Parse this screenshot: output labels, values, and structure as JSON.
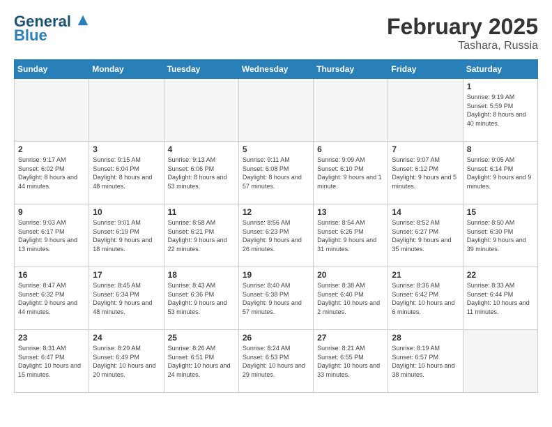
{
  "header": {
    "logo_line1": "General",
    "logo_line2": "Blue",
    "month_title": "February 2025",
    "location": "Tashara, Russia"
  },
  "days_of_week": [
    "Sunday",
    "Monday",
    "Tuesday",
    "Wednesday",
    "Thursday",
    "Friday",
    "Saturday"
  ],
  "weeks": [
    [
      {
        "day": "",
        "empty": true
      },
      {
        "day": "",
        "empty": true
      },
      {
        "day": "",
        "empty": true
      },
      {
        "day": "",
        "empty": true
      },
      {
        "day": "",
        "empty": true
      },
      {
        "day": "",
        "empty": true
      },
      {
        "day": "1",
        "sunrise": "9:19 AM",
        "sunset": "5:59 PM",
        "daylight": "8 hours and 40 minutes."
      }
    ],
    [
      {
        "day": "2",
        "sunrise": "9:17 AM",
        "sunset": "6:02 PM",
        "daylight": "8 hours and 44 minutes."
      },
      {
        "day": "3",
        "sunrise": "9:15 AM",
        "sunset": "6:04 PM",
        "daylight": "8 hours and 48 minutes."
      },
      {
        "day": "4",
        "sunrise": "9:13 AM",
        "sunset": "6:06 PM",
        "daylight": "8 hours and 53 minutes."
      },
      {
        "day": "5",
        "sunrise": "9:11 AM",
        "sunset": "6:08 PM",
        "daylight": "8 hours and 57 minutes."
      },
      {
        "day": "6",
        "sunrise": "9:09 AM",
        "sunset": "6:10 PM",
        "daylight": "9 hours and 1 minute."
      },
      {
        "day": "7",
        "sunrise": "9:07 AM",
        "sunset": "6:12 PM",
        "daylight": "9 hours and 5 minutes."
      },
      {
        "day": "8",
        "sunrise": "9:05 AM",
        "sunset": "6:14 PM",
        "daylight": "9 hours and 9 minutes."
      }
    ],
    [
      {
        "day": "9",
        "sunrise": "9:03 AM",
        "sunset": "6:17 PM",
        "daylight": "9 hours and 13 minutes."
      },
      {
        "day": "10",
        "sunrise": "9:01 AM",
        "sunset": "6:19 PM",
        "daylight": "9 hours and 18 minutes."
      },
      {
        "day": "11",
        "sunrise": "8:58 AM",
        "sunset": "6:21 PM",
        "daylight": "9 hours and 22 minutes."
      },
      {
        "day": "12",
        "sunrise": "8:56 AM",
        "sunset": "6:23 PM",
        "daylight": "9 hours and 26 minutes."
      },
      {
        "day": "13",
        "sunrise": "8:54 AM",
        "sunset": "6:25 PM",
        "daylight": "9 hours and 31 minutes."
      },
      {
        "day": "14",
        "sunrise": "8:52 AM",
        "sunset": "6:27 PM",
        "daylight": "9 hours and 35 minutes."
      },
      {
        "day": "15",
        "sunrise": "8:50 AM",
        "sunset": "6:30 PM",
        "daylight": "9 hours and 39 minutes."
      }
    ],
    [
      {
        "day": "16",
        "sunrise": "8:47 AM",
        "sunset": "6:32 PM",
        "daylight": "9 hours and 44 minutes."
      },
      {
        "day": "17",
        "sunrise": "8:45 AM",
        "sunset": "6:34 PM",
        "daylight": "9 hours and 48 minutes."
      },
      {
        "day": "18",
        "sunrise": "8:43 AM",
        "sunset": "6:36 PM",
        "daylight": "9 hours and 53 minutes."
      },
      {
        "day": "19",
        "sunrise": "8:40 AM",
        "sunset": "6:38 PM",
        "daylight": "9 hours and 57 minutes."
      },
      {
        "day": "20",
        "sunrise": "8:38 AM",
        "sunset": "6:40 PM",
        "daylight": "10 hours and 2 minutes."
      },
      {
        "day": "21",
        "sunrise": "8:36 AM",
        "sunset": "6:42 PM",
        "daylight": "10 hours and 6 minutes."
      },
      {
        "day": "22",
        "sunrise": "8:33 AM",
        "sunset": "6:44 PM",
        "daylight": "10 hours and 11 minutes."
      }
    ],
    [
      {
        "day": "23",
        "sunrise": "8:31 AM",
        "sunset": "6:47 PM",
        "daylight": "10 hours and 15 minutes."
      },
      {
        "day": "24",
        "sunrise": "8:29 AM",
        "sunset": "6:49 PM",
        "daylight": "10 hours and 20 minutes."
      },
      {
        "day": "25",
        "sunrise": "8:26 AM",
        "sunset": "6:51 PM",
        "daylight": "10 hours and 24 minutes."
      },
      {
        "day": "26",
        "sunrise": "8:24 AM",
        "sunset": "6:53 PM",
        "daylight": "10 hours and 29 minutes."
      },
      {
        "day": "27",
        "sunrise": "8:21 AM",
        "sunset": "6:55 PM",
        "daylight": "10 hours and 33 minutes."
      },
      {
        "day": "28",
        "sunrise": "8:19 AM",
        "sunset": "6:57 PM",
        "daylight": "10 hours and 38 minutes."
      },
      {
        "day": "",
        "empty": true
      }
    ]
  ]
}
